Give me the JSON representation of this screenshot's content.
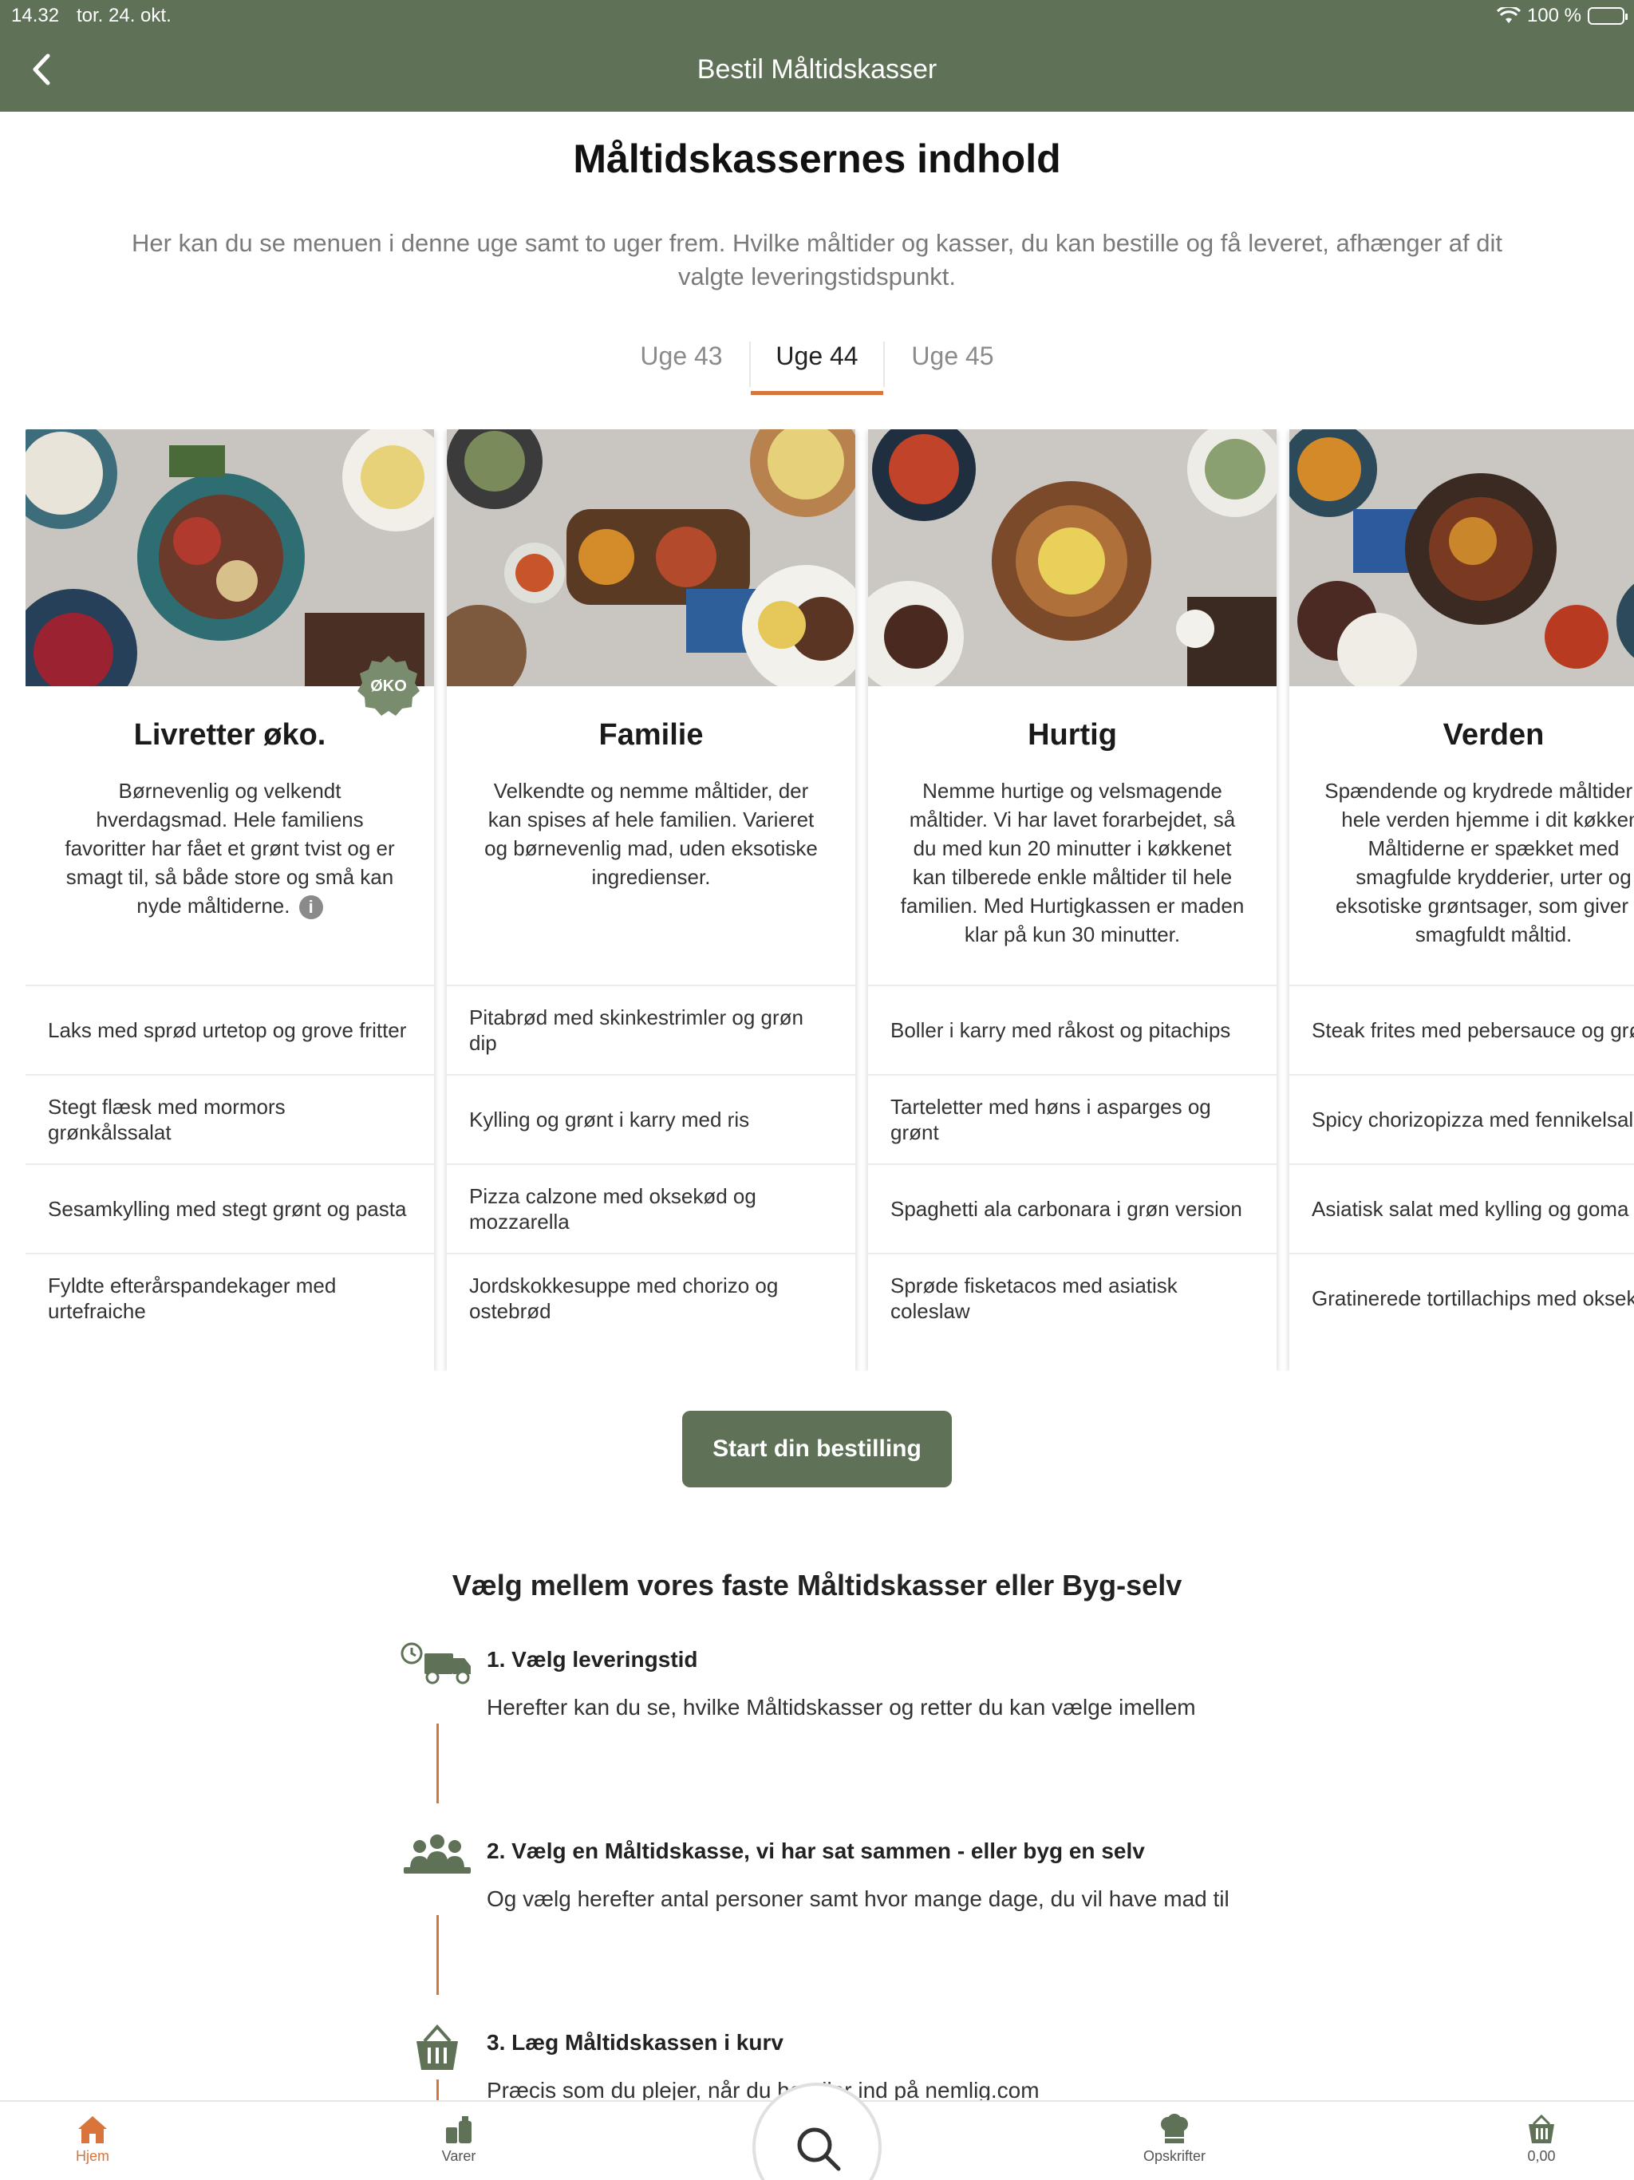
{
  "status": {
    "time": "14.32",
    "date": "tor. 24. okt.",
    "battery": "100 %"
  },
  "nav": {
    "title": "Bestil Måltidskasser"
  },
  "page": {
    "heading": "Måltidskassernes indhold",
    "intro": "Her kan du se menuen i denne uge samt to uger frem. Hvilke måltider og kasser, du kan bestille og få leveret, afhænger af dit valgte leveringstidspunkt."
  },
  "tabs": [
    {
      "label": "Uge 43",
      "active": false
    },
    {
      "label": "Uge 44",
      "active": true
    },
    {
      "label": "Uge 45",
      "active": false
    }
  ],
  "cards": [
    {
      "title": "Livretter øko.",
      "badge": "ØKO",
      "description": "Børnevenlig og velkendt hverdagsmad. Hele familiens favoritter har fået et grønt tvist og er smagt til, så både store og små kan nyde måltiderne.",
      "items": [
        "Laks med sprød urtetop og grove fritter",
        "Stegt flæsk med mormors grønkålssalat",
        "Sesamkylling med stegt grønt og pasta",
        "Fyldte efterårspandekager med urtefraiche"
      ]
    },
    {
      "title": "Familie",
      "description": "Velkendte og nemme måltider, der kan spises af hele familien.  Varieret og børnevenlig mad, uden eksotiske ingredienser.",
      "items": [
        "Pitabrød med skinkestrimler og grøn dip",
        "Kylling og grønt i karry med ris",
        "Pizza calzone med oksekød og mozzarella",
        "Jordskokkesuppe med chorizo og ostebrød"
      ]
    },
    {
      "title": "Hurtig",
      "description": "Nemme hurtige og velsmagende måltider. Vi har lavet forarbejdet, så du med kun 20 minutter i køkkenet kan tilberede enkle måltider til hele familien. Med Hurtigkassen er maden klar på kun 30 minutter.",
      "items": [
        "Boller i karry med råkost og pitachips",
        "Tarteletter med høns i asparges og grønt",
        "Spaghetti ala carbonara i grøn version",
        "Sprøde fisketacos med asiatisk coleslaw"
      ]
    },
    {
      "title": "Verden",
      "description": "Spændende og krydrede måltider fra hele verden hjemme i dit køkken. Måltiderne er spækket med smagfulde krydderier, urter og eksotiske grøntsager, som giver et smagfuldt måltid.",
      "items": [
        "Steak frites med pebersauce og grønt",
        "Spicy chorizopizza med fennikelsalat",
        "Asiatisk salat med kylling og goma",
        "Gratinerede tortillachips med oksekød"
      ]
    }
  ],
  "start_button": "Start din bestilling",
  "steps_heading": "Vælg mellem vores faste Måltidskasser eller Byg-selv",
  "steps": [
    {
      "title": "1. Vælg leveringstid",
      "text": "Herefter kan du se, hvilke Måltidskasser og retter du kan vælge imellem",
      "icon": "delivery-truck-icon"
    },
    {
      "title": "2. Vælg en Måltidskasse, vi har sat sammen - eller byg en selv",
      "text": "Og vælg herefter antal personer samt hvor mange dage, du vil have mad til",
      "icon": "people-group-icon"
    },
    {
      "title": "3. Læg Måltidskassen i kurv",
      "text": "Præcis som du plejer, når du handler ind på nemlig.com",
      "icon": "basket-icon"
    }
  ],
  "tabbar": {
    "home": "Hjem",
    "products": "Varer",
    "recipes": "Opskrifter",
    "basket": "0,00"
  },
  "colors": {
    "brand_green": "#5f7258",
    "accent_orange": "#d9743a"
  }
}
